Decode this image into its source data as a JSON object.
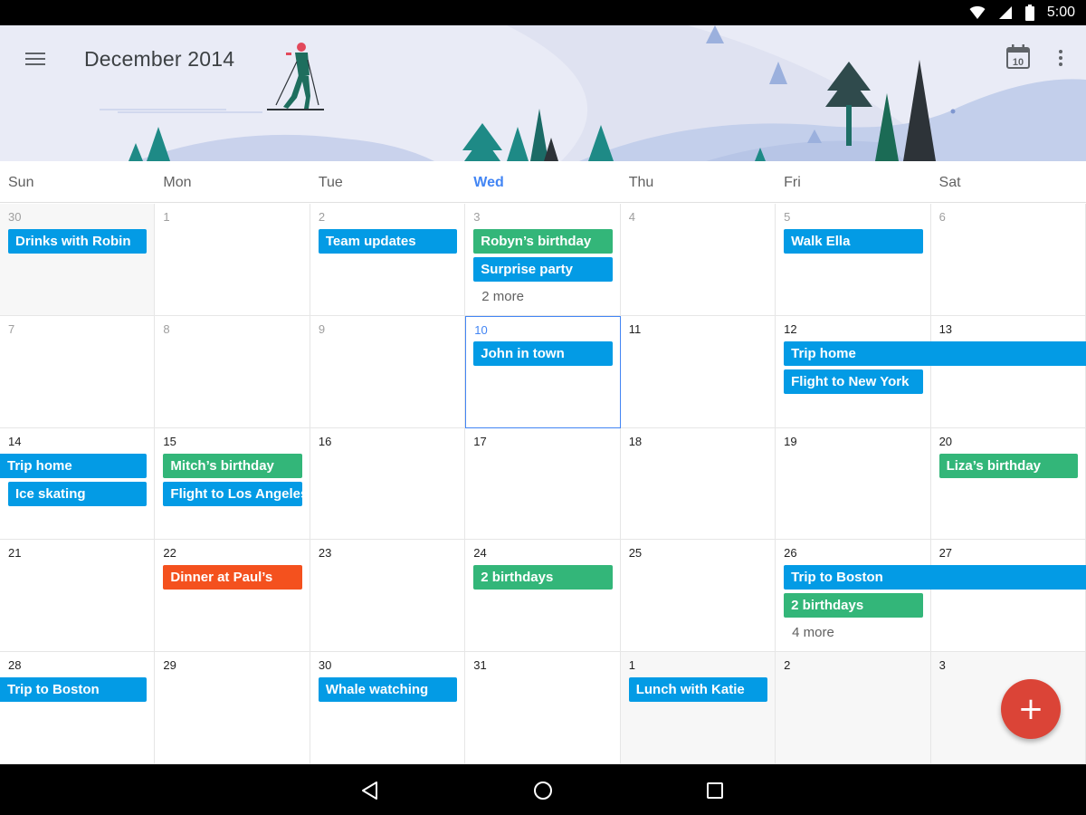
{
  "status_bar": {
    "time": "5:00"
  },
  "header": {
    "title": "December 2014",
    "today_day": "10"
  },
  "weekdays": [
    "Sun",
    "Mon",
    "Tue",
    "Wed",
    "Thu",
    "Fri",
    "Sat"
  ],
  "today_weekday_index": 3,
  "weeks": [
    [
      {
        "day": "30",
        "out": true,
        "dim": true
      },
      {
        "day": "1",
        "dim": true
      },
      {
        "day": "2",
        "dim": true
      },
      {
        "day": "3",
        "dim": true
      },
      {
        "day": "4",
        "dim": true
      },
      {
        "day": "5",
        "dim": true
      },
      {
        "day": "6",
        "dim": true
      }
    ],
    [
      {
        "day": "7",
        "dim": true
      },
      {
        "day": "8",
        "dim": true
      },
      {
        "day": "9",
        "dim": true
      },
      {
        "day": "10",
        "today": true
      },
      {
        "day": "11"
      },
      {
        "day": "12"
      },
      {
        "day": "13"
      }
    ],
    [
      {
        "day": "14"
      },
      {
        "day": "15"
      },
      {
        "day": "16"
      },
      {
        "day": "17"
      },
      {
        "day": "18"
      },
      {
        "day": "19"
      },
      {
        "day": "20"
      }
    ],
    [
      {
        "day": "21"
      },
      {
        "day": "22"
      },
      {
        "day": "23"
      },
      {
        "day": "24"
      },
      {
        "day": "25"
      },
      {
        "day": "26"
      },
      {
        "day": "27"
      }
    ],
    [
      {
        "day": "28"
      },
      {
        "day": "29"
      },
      {
        "day": "30"
      },
      {
        "day": "31"
      },
      {
        "day": "1",
        "out": true
      },
      {
        "day": "2",
        "out": true
      },
      {
        "day": "3",
        "out": true
      }
    ]
  ],
  "events": [
    {
      "title": "Drinks with Robin",
      "week": 0,
      "col": 0,
      "slot": 0,
      "span": 1,
      "color": "#039be5"
    },
    {
      "title": "Team updates",
      "week": 0,
      "col": 2,
      "slot": 0,
      "span": 1,
      "color": "#039be5"
    },
    {
      "title": "Robyn’s birthday",
      "week": 0,
      "col": 3,
      "slot": 0,
      "span": 1,
      "color": "#33b679"
    },
    {
      "title": "Surprise party",
      "week": 0,
      "col": 3,
      "slot": 1,
      "span": 1,
      "color": "#039be5"
    },
    {
      "title": "Walk Ella",
      "week": 0,
      "col": 5,
      "slot": 0,
      "span": 1,
      "color": "#039be5"
    },
    {
      "title": "John in town",
      "week": 1,
      "col": 3,
      "slot": 0,
      "span": 1,
      "color": "#039be5"
    },
    {
      "title": "Trip home",
      "week": 1,
      "col": 5,
      "slot": 0,
      "span": 2,
      "color": "#039be5",
      "cont_right": true
    },
    {
      "title": "Flight to New York",
      "week": 1,
      "col": 5,
      "slot": 1,
      "span": 1,
      "color": "#039be5"
    },
    {
      "title": "Trip home",
      "week": 2,
      "col": 0,
      "slot": 0,
      "span": 1,
      "color": "#039be5",
      "cont_left": true
    },
    {
      "title": "Ice skating",
      "week": 2,
      "col": 0,
      "slot": 1,
      "span": 1,
      "color": "#039be5"
    },
    {
      "title": "Mitch’s birthday",
      "week": 2,
      "col": 1,
      "slot": 0,
      "span": 1,
      "color": "#33b679"
    },
    {
      "title": "Flight to Los Angeles",
      "week": 2,
      "col": 1,
      "slot": 1,
      "span": 1,
      "color": "#039be5"
    },
    {
      "title": "Liza’s birthday",
      "week": 2,
      "col": 6,
      "slot": 0,
      "span": 1,
      "color": "#33b679"
    },
    {
      "title": "Dinner at Paul’s",
      "week": 3,
      "col": 1,
      "slot": 0,
      "span": 1,
      "color": "#f4511e"
    },
    {
      "title": "2 birthdays",
      "week": 3,
      "col": 3,
      "slot": 0,
      "span": 1,
      "color": "#33b679"
    },
    {
      "title": "Trip to Boston",
      "week": 3,
      "col": 5,
      "slot": 0,
      "span": 2,
      "color": "#039be5",
      "cont_right": true
    },
    {
      "title": "2 birthdays",
      "week": 3,
      "col": 5,
      "slot": 1,
      "span": 1,
      "color": "#33b679"
    },
    {
      "title": "Trip to Boston",
      "week": 4,
      "col": 0,
      "slot": 0,
      "span": 1,
      "color": "#039be5",
      "cont_left": true
    },
    {
      "title": "Whale watching",
      "week": 4,
      "col": 2,
      "slot": 0,
      "span": 1,
      "color": "#039be5"
    },
    {
      "title": "Lunch with Katie",
      "week": 4,
      "col": 4,
      "slot": 0,
      "span": 1,
      "color": "#039be5"
    }
  ],
  "more_links": [
    {
      "text": "2 more",
      "week": 0,
      "col": 3
    },
    {
      "text": "4 more",
      "week": 3,
      "col": 5
    }
  ],
  "colors": {
    "accent_blue": "#4285f4",
    "event_blue": "#039be5",
    "event_green": "#33b679",
    "event_orange": "#f4511e",
    "fab_red": "#db4437"
  }
}
